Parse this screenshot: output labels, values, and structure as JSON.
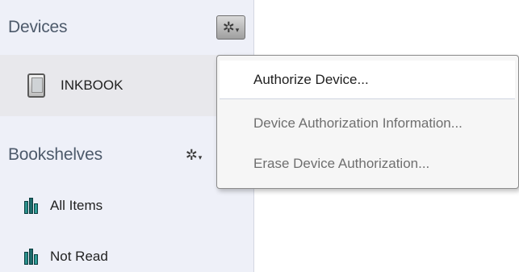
{
  "sidebar": {
    "devices_title": "Devices",
    "devices_gear_icon": "gear-icon",
    "device": {
      "label": "INKBOOK",
      "icon": "ereader-device-icon"
    },
    "bookshelves_title": "Bookshelves",
    "bookshelves_gear_icon": "gear-icon",
    "shelves": [
      {
        "label": "All Items",
        "icon": "books-icon"
      },
      {
        "label": "Not Read",
        "icon": "books-icon"
      }
    ]
  },
  "menu": {
    "items": [
      {
        "label": "Authorize Device...",
        "state": "highlighted"
      },
      {
        "label": "Device Authorization Information...",
        "state": "normal"
      },
      {
        "label": "Erase Device Authorization...",
        "state": "normal"
      }
    ]
  },
  "glyphs": {
    "gear": "✲",
    "caret": "▾"
  }
}
